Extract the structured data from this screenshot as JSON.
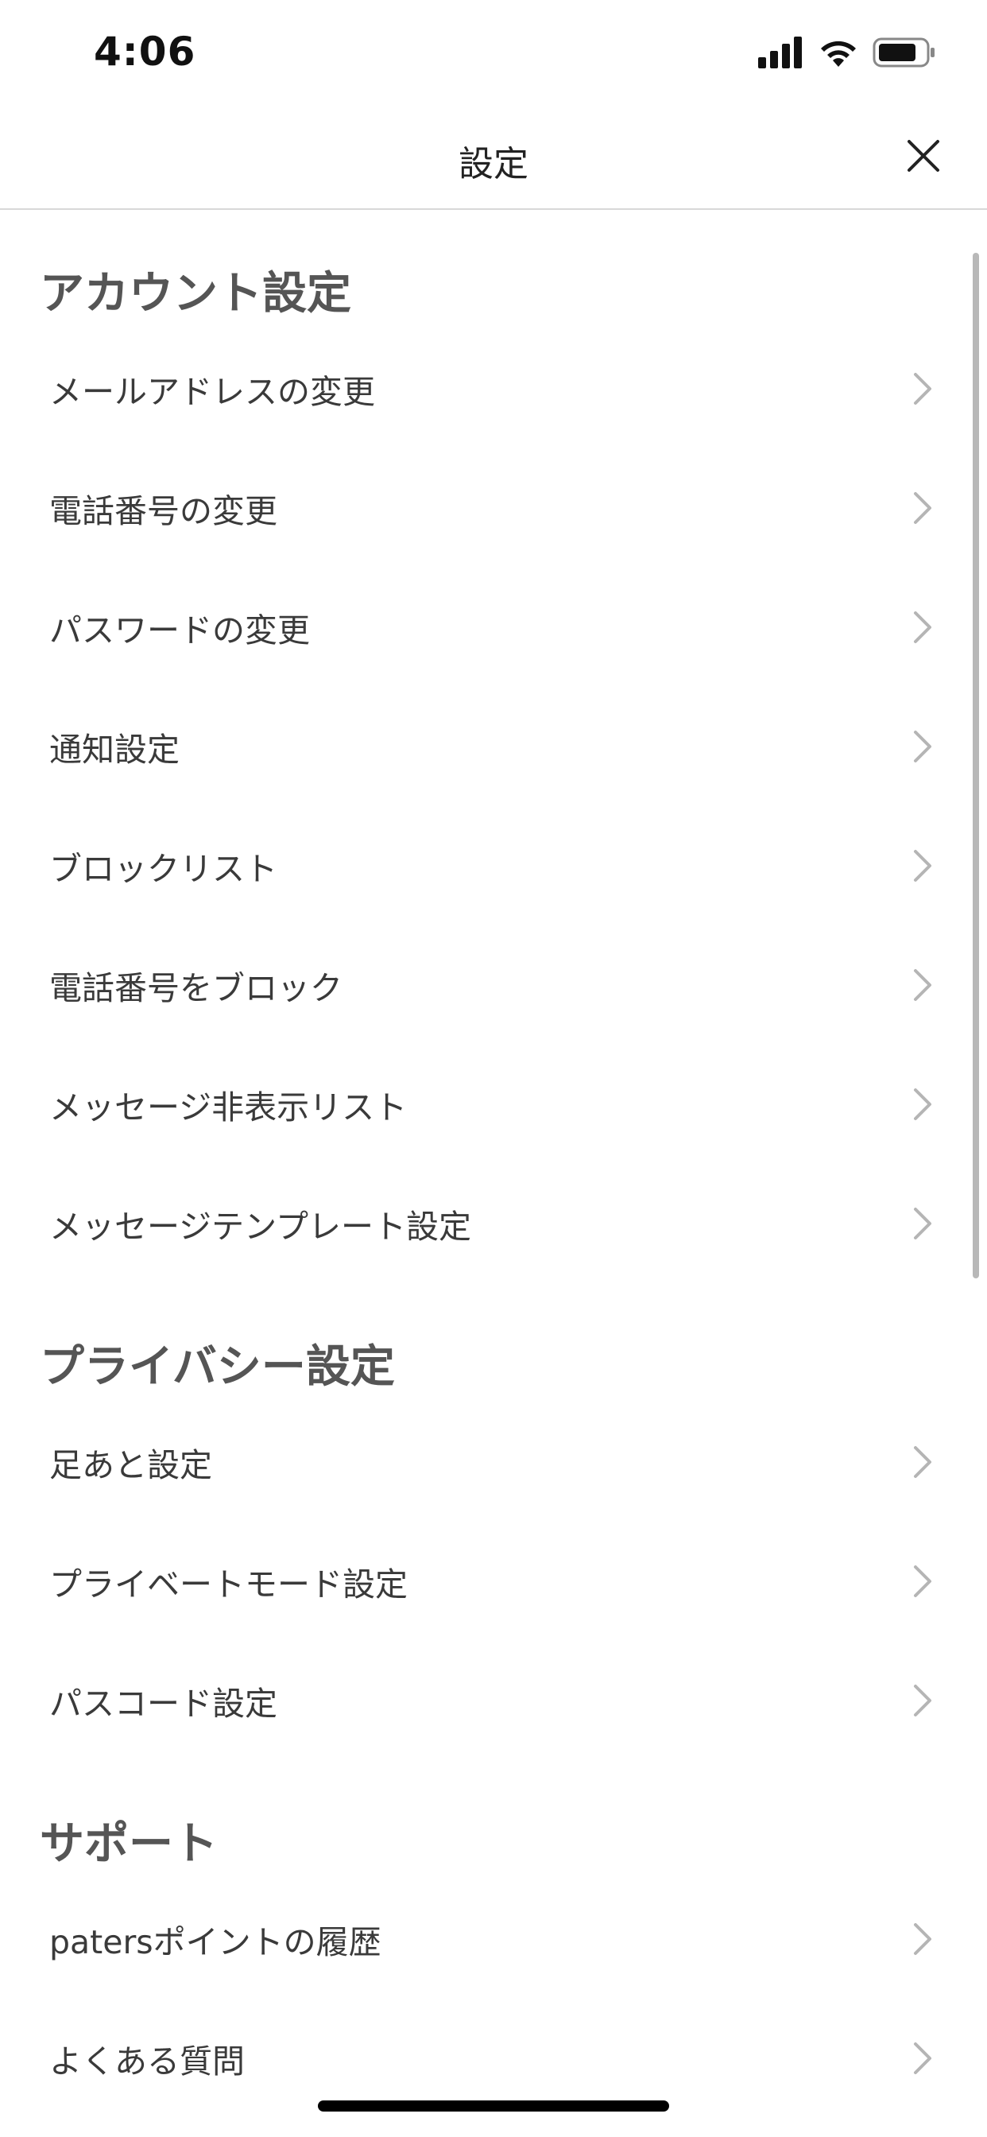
{
  "status_bar": {
    "time": "4:06",
    "icons": [
      "signal-icon",
      "wifi-icon",
      "battery-icon"
    ]
  },
  "header": {
    "title": "設定",
    "close_icon": "close-icon"
  },
  "sections": [
    {
      "heading": "アカウント設定",
      "items": [
        {
          "label": "メールアドレスの変更"
        },
        {
          "label": "電話番号の変更"
        },
        {
          "label": "パスワードの変更"
        },
        {
          "label": "通知設定"
        },
        {
          "label": "ブロックリスト"
        },
        {
          "label": "電話番号をブロック"
        },
        {
          "label": "メッセージ非表示リスト"
        },
        {
          "label": "メッセージテンプレート設定"
        }
      ]
    },
    {
      "heading": "プライバシー設定",
      "items": [
        {
          "label": "足あと設定"
        },
        {
          "label": "プライベートモード設定"
        },
        {
          "label": "パスコード設定"
        }
      ]
    },
    {
      "heading": "サポート",
      "items": [
        {
          "label": "patersポイントの履歴"
        },
        {
          "label": "よくある質問"
        }
      ]
    }
  ],
  "colors": {
    "text": "#333333",
    "heading": "#555555",
    "chevron": "#b5b5b5",
    "divider": "#d8d8d8"
  }
}
